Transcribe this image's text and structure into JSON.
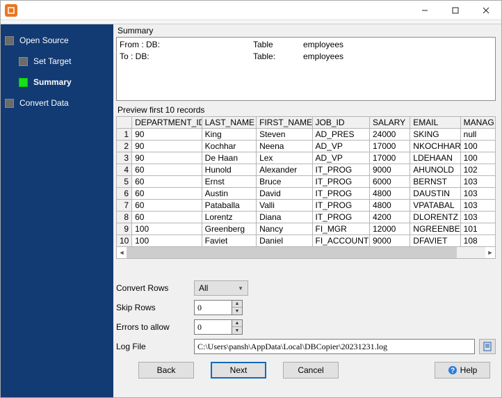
{
  "nav": {
    "items": [
      {
        "label": "Open Source"
      },
      {
        "label": "Set Target"
      },
      {
        "label": "Summary"
      },
      {
        "label": "Convert Data"
      }
    ]
  },
  "summary": {
    "title": "Summary",
    "from_label": "From : DB:",
    "from_table_label": "Table",
    "from_table_value": "employees",
    "to_label": "To : DB:",
    "to_table_label": "Table:",
    "to_table_value": "employees"
  },
  "preview": {
    "title": "Preview first 10 records",
    "columns": [
      "DEPARTMENT_ID",
      "LAST_NAME",
      "FIRST_NAME",
      "JOB_ID",
      "SALARY",
      "EMAIL",
      "MANAG"
    ],
    "rows": [
      [
        "90",
        "King",
        "Steven",
        "AD_PRES",
        "24000",
        "SKING",
        "null"
      ],
      [
        "90",
        "Kochhar",
        "Neena",
        "AD_VP",
        "17000",
        "NKOCHHAR",
        "100"
      ],
      [
        "90",
        "De Haan",
        "Lex",
        "AD_VP",
        "17000",
        "LDEHAAN",
        "100"
      ],
      [
        "60",
        "Hunold",
        "Alexander",
        "IT_PROG",
        "9000",
        "AHUNOLD",
        "102"
      ],
      [
        "60",
        "Ernst",
        "Bruce",
        "IT_PROG",
        "6000",
        "BERNST",
        "103"
      ],
      [
        "60",
        "Austin",
        "David",
        "IT_PROG",
        "4800",
        "DAUSTIN",
        "103"
      ],
      [
        "60",
        "Pataballa",
        "Valli",
        "IT_PROG",
        "4800",
        "VPATABAL",
        "103"
      ],
      [
        "60",
        "Lorentz",
        "Diana",
        "IT_PROG",
        "4200",
        "DLORENTZ",
        "103"
      ],
      [
        "100",
        "Greenberg",
        "Nancy",
        "FI_MGR",
        "12000",
        "NGREENBE",
        "101"
      ],
      [
        "100",
        "Faviet",
        "Daniel",
        "FI_ACCOUNT",
        "9000",
        "DFAVIET",
        "108"
      ]
    ]
  },
  "form": {
    "convert_rows_label": "Convert Rows",
    "convert_rows_value": "All",
    "skip_rows_label": "Skip Rows",
    "skip_rows_value": "0",
    "errors_label": "Errors to allow",
    "errors_value": "0",
    "log_label": "Log File",
    "log_value": "C:\\Users\\pansh\\AppData\\Local\\DBCopier\\20231231.log"
  },
  "actions": {
    "back": "Back",
    "next": "Next",
    "cancel": "Cancel",
    "help": "Help"
  }
}
